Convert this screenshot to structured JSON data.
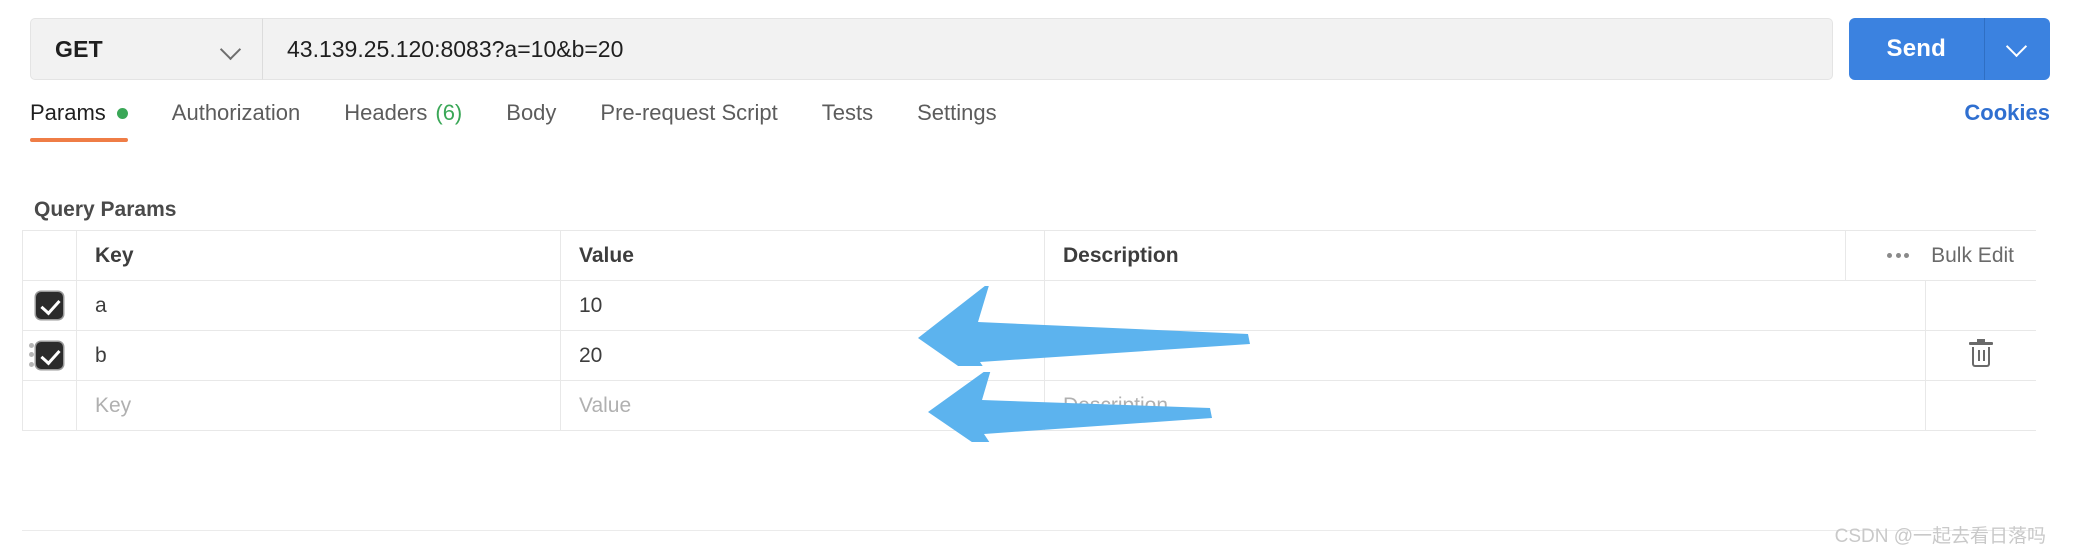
{
  "request": {
    "method": "GET",
    "method_chevron_icon": "chevron-down-icon",
    "url": "43.139.25.120:8083?a=10&b=20",
    "url_placeholder": "Enter request URL",
    "send_label": "Send",
    "send_caret_icon": "chevron-down-icon"
  },
  "tabs": [
    {
      "label": "Params",
      "active": true,
      "dot": true,
      "count": ""
    },
    {
      "label": "Authorization",
      "active": false,
      "dot": false,
      "count": ""
    },
    {
      "label": "Headers",
      "active": false,
      "dot": false,
      "count": "(6)"
    },
    {
      "label": "Body",
      "active": false,
      "dot": false,
      "count": ""
    },
    {
      "label": "Pre-request Script",
      "active": false,
      "dot": false,
      "count": ""
    },
    {
      "label": "Tests",
      "active": false,
      "dot": false,
      "count": ""
    },
    {
      "label": "Settings",
      "active": false,
      "dot": false,
      "count": ""
    }
  ],
  "cookies_label": "Cookies",
  "section": {
    "title": "Query Params"
  },
  "table": {
    "headers": {
      "key": "Key",
      "value": "Value",
      "description": "Description"
    },
    "bulk_edit_label": "Bulk Edit",
    "bulk_edit_icon": "ellipsis-icon",
    "rows": [
      {
        "checked": true,
        "key": "a",
        "value": "10",
        "description": "",
        "has_drag": false,
        "has_delete": false
      },
      {
        "checked": true,
        "key": "b",
        "value": "20",
        "description": "",
        "has_drag": true,
        "has_delete": true
      }
    ],
    "placeholder_row": {
      "key": "Key",
      "value": "Value",
      "description": "Description"
    },
    "delete_icon": "trash-icon",
    "drag_icon": "drag-handle-icon"
  },
  "annotations": {
    "arrows": [
      {
        "name": "arrow-pointing-to-value-10",
        "color": "#5cb3ee"
      },
      {
        "name": "arrow-pointing-to-value-20",
        "color": "#5cb3ee"
      }
    ]
  },
  "watermark": "CSDN @一起去看日落吗",
  "colors": {
    "accent_orange": "#ef7d46",
    "send_blue": "#3b82e0",
    "link_blue": "#2f6fd0",
    "dot_green": "#3aa757",
    "arrow_blue": "#5cb3ee"
  }
}
